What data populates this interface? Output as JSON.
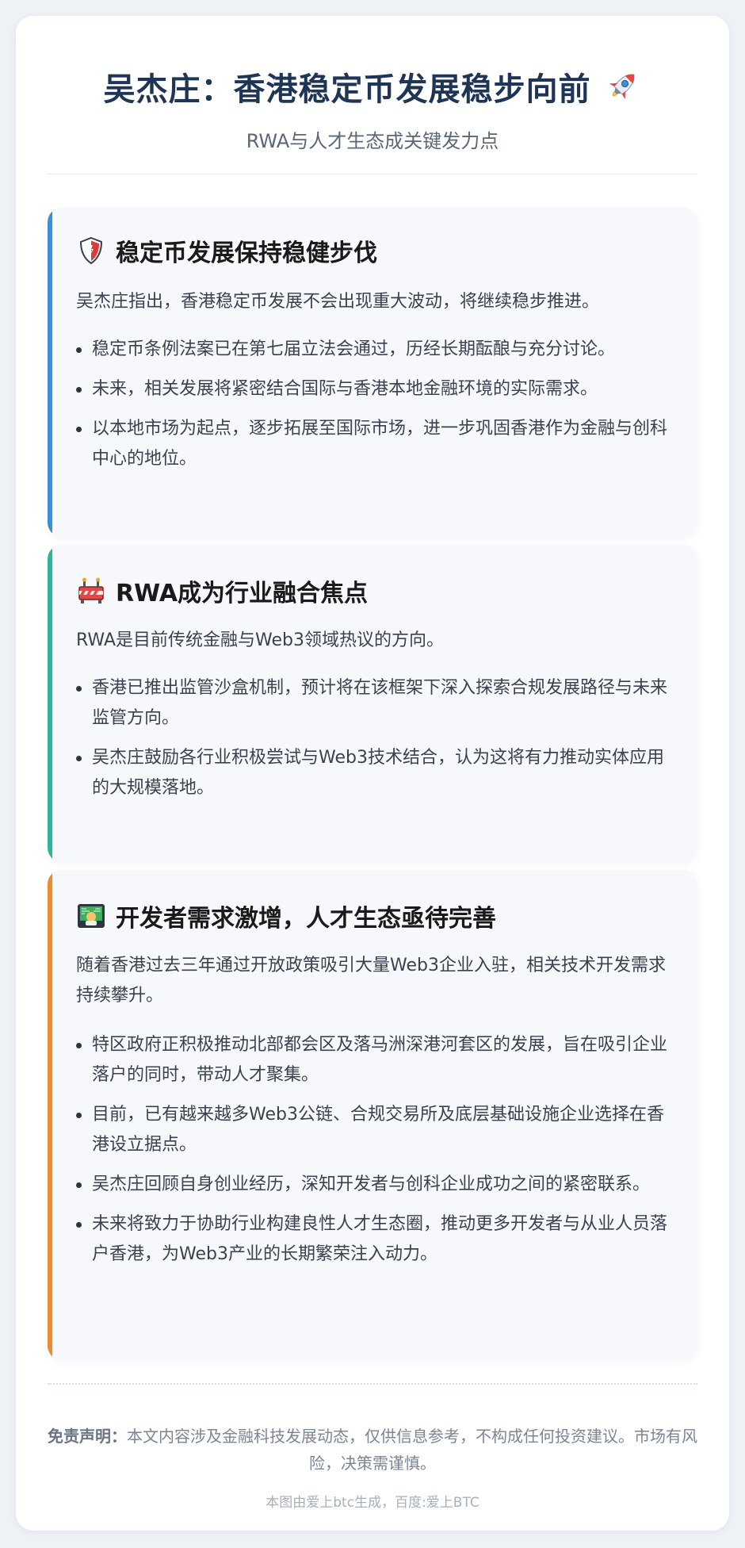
{
  "header": {
    "title": "吴杰庄：香港稳定币发展稳步向前",
    "title_icon": "rocket-icon",
    "subtitle": "RWA与人才生态成关键发力点"
  },
  "sections": [
    {
      "accent": "#3a8fd9",
      "icon": "shield-icon",
      "title": "稳定币发展保持稳健步伐",
      "intro": "吴杰庄指出，香港稳定币发展不会出现重大波动，将继续稳步推进。",
      "points": [
        "稳定币条例法案已在第七届立法会通过，历经长期酝酿与充分讨论。",
        "未来，相关发展将紧密结合国际与香港本地金融环境的实际需求。",
        "以本地市场为起点，逐步拓展至国际市场，进一步巩固香港作为金融与创科中心的地位。"
      ]
    },
    {
      "accent": "#2bb5a0",
      "icon": "construction-icon",
      "title": "RWA成为行业融合焦点",
      "intro": "RWA是目前传统金融与Web3领域热议的方向。",
      "points": [
        "香港已推出监管沙盒机制，预计将在该框架下深入探索合规发展路径与未来监管方向。",
        "吴杰庄鼓励各行业积极尝试与Web3技术结合，认为这将有力推动实体应用的大规模落地。"
      ]
    },
    {
      "accent": "#f08a2c",
      "icon": "developer-icon",
      "title": "开发者需求激增，人才生态亟待完善",
      "intro": "随着香港过去三年通过开放政策吸引大量Web3企业入驻，相关技术开发需求持续攀升。",
      "points": [
        "特区政府正积极推动北部都会区及落马洲深港河套区的发展，旨在吸引企业落户的同时，带动人才聚集。",
        "目前，已有越来越多Web3公链、合规交易所及底层基础设施企业选择在香港设立据点。",
        "吴杰庄回顾自身创业经历，深知开发者与创科企业成功之间的紧密联系。",
        "未来将致力于协助行业构建良性人才生态圈，推动更多开发者与从业人员落户香港，为Web3产业的长期繁荣注入动力。"
      ]
    }
  ],
  "disclaimer": {
    "label": "免责声明：",
    "text": "本文内容涉及金融科技发展动态，仅供信息参考，不构成任何投资建议。市场有风险，决策需谨慎。"
  },
  "footer": "本图由爱上btc生成，百度:爱上BTC"
}
